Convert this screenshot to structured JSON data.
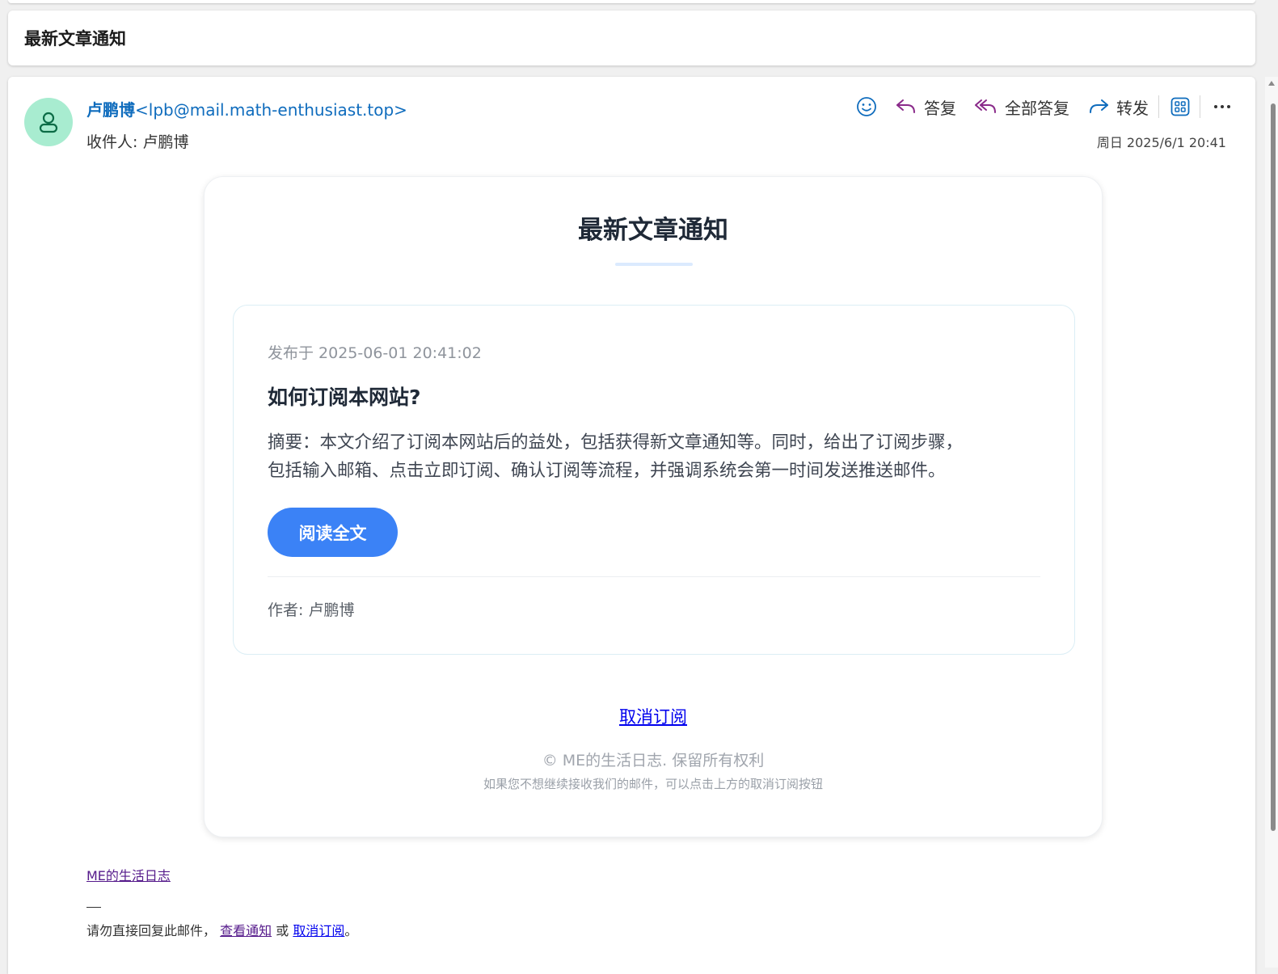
{
  "subject": "最新文章通知",
  "sender": {
    "name": "卢鹏博",
    "email": "<lpb@mail.math-enthusiast.top>",
    "avatar_color": "#a8ecd0"
  },
  "recipient": {
    "label": "收件人:",
    "name": "卢鹏博"
  },
  "date": "周日 2025/6/1 20:41",
  "actions": {
    "emoji_icon": "smiley-icon",
    "reply": "答复",
    "reply_all": "全部答复",
    "forward": "转发",
    "apps_icon": "apps-grid-icon",
    "more_icon": "more-horizontal-icon"
  },
  "card": {
    "title": "最新文章通知",
    "article": {
      "published": "发布于 2025-06-01 20:41:02",
      "title": "如何订阅本网站?",
      "summary_line1": "摘要：本文介绍了订阅本网站后的益处，包括获得新文章通知等。同时，给出了订阅步骤，",
      "summary_line2": "包括输入邮箱、点击立即订阅、确认订阅等流程，并强调系统会第一时间发送推送邮件。",
      "read_button": "阅读全文",
      "author": "作者: 卢鹏博"
    },
    "unsubscribe": "取消订阅",
    "copyright": "© ME的生活日志. 保留所有权利",
    "footnote": "如果您不想继续接收我们的邮件，可以点击上方的取消订阅按钮"
  },
  "footer": {
    "site_link": "ME的生活日志",
    "dash": "—",
    "note_prefix": "请勿直接回复此邮件，",
    "view_link": "查看通知",
    "or": "或",
    "unsubscribe_link": "取消订阅",
    "period": "。"
  },
  "colors": {
    "accent_blue": "#3b82f6",
    "link_blue": "#0f6cbd",
    "action_purple": "#8a2a8a"
  }
}
